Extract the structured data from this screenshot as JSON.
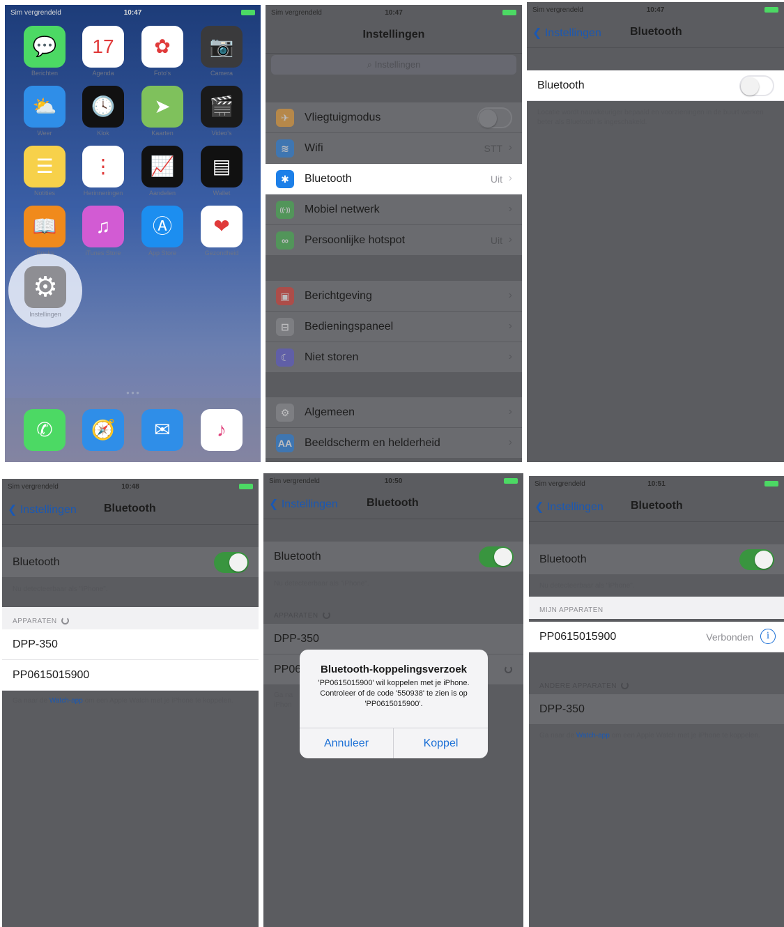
{
  "status": {
    "carrier": "Sim vergrendeld",
    "time1": "10:47",
    "time4": "10:48",
    "time5": "10:50",
    "time6": "10:51"
  },
  "home": {
    "apps": [
      {
        "label": "Berichten",
        "icon": "messages-icon",
        "color": "#4cd964",
        "glyph": "💬"
      },
      {
        "label": "Agenda",
        "icon": "calendar-icon",
        "color": "#ffffff",
        "glyph": "17"
      },
      {
        "label": "Foto's",
        "icon": "photos-icon",
        "color": "#ffffff",
        "glyph": "✿"
      },
      {
        "label": "Camera",
        "icon": "camera-icon",
        "color": "#3a3a3c",
        "glyph": "📷"
      },
      {
        "label": "Weer",
        "icon": "weather-icon",
        "color": "#2f8ee8",
        "glyph": "⛅"
      },
      {
        "label": "Klok",
        "icon": "clock-icon",
        "color": "#111111",
        "glyph": "🕓"
      },
      {
        "label": "Kaarten",
        "icon": "maps-icon",
        "color": "#7fc15c",
        "glyph": "➤"
      },
      {
        "label": "Video's",
        "icon": "videos-icon",
        "color": "#1a1a1a",
        "glyph": "🎬"
      },
      {
        "label": "Notities",
        "icon": "notes-icon",
        "color": "#f7d14a",
        "glyph": "☰"
      },
      {
        "label": "Herinneringen",
        "icon": "reminders-icon",
        "color": "#ffffff",
        "glyph": "⋮"
      },
      {
        "label": "Aandelen",
        "icon": "stocks-icon",
        "color": "#111111",
        "glyph": "📈"
      },
      {
        "label": "Wallet",
        "icon": "wallet-icon",
        "color": "#111111",
        "glyph": "▤"
      },
      {
        "label": "iBooks",
        "icon": "ibooks-icon",
        "color": "#f08a1c",
        "glyph": "📖"
      },
      {
        "label": "iTunes Store",
        "icon": "itunes-icon",
        "color": "#d25bd3",
        "glyph": "♫"
      },
      {
        "label": "App Store",
        "icon": "appstore-icon",
        "color": "#1c8ef0",
        "glyph": "Ⓐ"
      },
      {
        "label": "Gezondheid",
        "icon": "health-icon",
        "color": "#ffffff",
        "glyph": "❤"
      }
    ],
    "settings_app": {
      "label": "Instellingen",
      "icon": "settings-gear-icon",
      "glyph": "⚙"
    },
    "dock": [
      {
        "icon": "phone-icon",
        "color": "#4cd964",
        "glyph": "✆"
      },
      {
        "icon": "safari-icon",
        "color": "#2f8ee8",
        "glyph": "🧭"
      },
      {
        "icon": "mail-icon",
        "color": "#2f8ee8",
        "glyph": "✉"
      },
      {
        "icon": "music-icon",
        "color": "#ffffff",
        "glyph": "♪"
      }
    ]
  },
  "settings": {
    "title": "Instellingen",
    "search_placeholder": "Instellingen",
    "group1": [
      {
        "label": "Vliegtuigmodus",
        "icon": "airplane-icon",
        "color": "#f4a12c",
        "glyph": "✈",
        "type": "toggle"
      },
      {
        "label": "Wifi",
        "icon": "wifi-icon",
        "color": "#1c7fe8",
        "glyph": "≋",
        "value": "STT",
        "type": "chevron"
      },
      {
        "label": "Bluetooth",
        "icon": "bluetooth-icon",
        "color": "#1c7fe8",
        "glyph": "✱",
        "value": "Uit",
        "type": "chevron",
        "highlighted": true
      },
      {
        "label": "Mobiel netwerk",
        "icon": "cellular-icon",
        "color": "#3fb94a",
        "glyph": "((·))",
        "value": "",
        "type": "chevron"
      },
      {
        "label": "Persoonlijke hotspot",
        "icon": "hotspot-icon",
        "color": "#3fb94a",
        "glyph": "∞",
        "value": "Uit",
        "type": "chevron"
      }
    ],
    "group2": [
      {
        "label": "Berichtgeving",
        "icon": "notifications-icon",
        "color": "#e2352b",
        "glyph": "▣"
      },
      {
        "label": "Bedieningspaneel",
        "icon": "control-center-icon",
        "color": "#8e8e93",
        "glyph": "⊟"
      },
      {
        "label": "Niet storen",
        "icon": "moon-icon",
        "color": "#5856d6",
        "glyph": "☾"
      }
    ],
    "group3": [
      {
        "label": "Algemeen",
        "icon": "general-gear-icon",
        "color": "#8e8e93",
        "glyph": "⚙"
      },
      {
        "label": "Beeldscherm en helderheid",
        "icon": "display-icon",
        "color": "#1c7fe8",
        "glyph": "AA"
      }
    ]
  },
  "bluetooth": {
    "back_label": "Instellingen",
    "title": "Bluetooth",
    "toggle_label": "Bluetooth",
    "off_footer": "Locatie wordt nauwkeuriger bepaald en voorzieningen in de buurt werken beter als Bluetooth is ingeschakeld.",
    "discoverable": "Nu detecteerbaar als \"iPhone\".",
    "devices_header": "APPARATEN",
    "my_devices_header": "MIJN APPARATEN",
    "other_devices_header": "ANDERE APPARATEN",
    "device1": "DPP-350",
    "device2": "PP0615015900",
    "device2_partial": "PP06",
    "connected_status": "Verbonden",
    "watch_footer_pre": "Ga naar de ",
    "watch_link": "Watch-app",
    "watch_footer_post": " om een Apple Watch met je iPhone te koppelen.",
    "watch_footer_partial_1": "Ga na",
    "watch_footer_partial_2": "iPhon"
  },
  "dialog": {
    "title": "Bluetooth-koppelingsverzoek",
    "message": "'PP0615015900' wil koppelen met je iPhone. Controleer of de code '550938' te zien is op 'PP0615015900'.",
    "cancel": "Annuleer",
    "confirm": "Koppel"
  },
  "colors": {
    "accent": "#1a58b3",
    "switch_on": "#39953f"
  }
}
